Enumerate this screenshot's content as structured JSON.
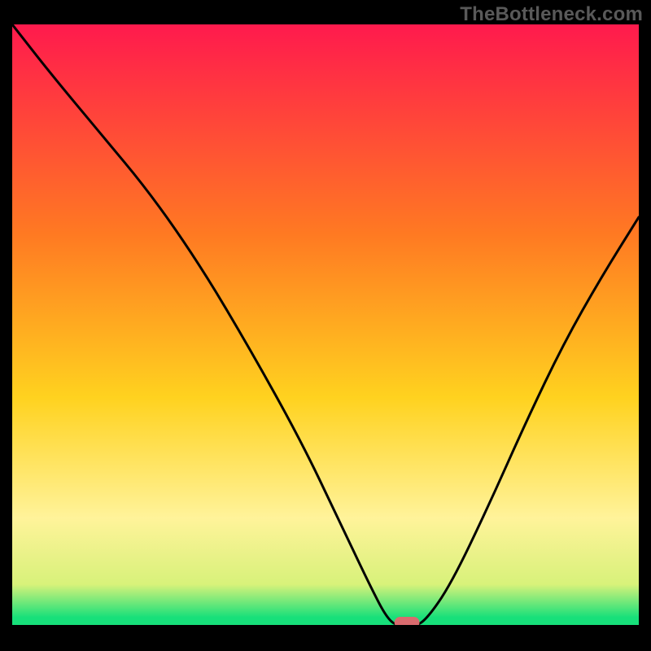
{
  "watermark": "TheBottleneck.com",
  "colors": {
    "plot_bg_top": "#ff1a4d",
    "plot_bg_mid1": "#ff7a22",
    "plot_bg_mid2": "#ffd21f",
    "plot_bg_low": "#fff39a",
    "plot_bg_green": "#17e07a",
    "curve": "#000000",
    "marker": "#d96b6e",
    "frame": "#000000"
  },
  "chart_data": {
    "type": "line",
    "title": "",
    "xlabel": "",
    "ylabel": "",
    "xlim": [
      0,
      100
    ],
    "ylim": [
      0,
      100
    ],
    "x": [
      0,
      6,
      14,
      22,
      30,
      38,
      46,
      52,
      57,
      60,
      62,
      64,
      66,
      70,
      76,
      82,
      88,
      94,
      100
    ],
    "values": [
      100,
      92,
      82,
      72,
      60,
      46,
      31,
      18,
      7,
      1,
      0,
      0,
      1,
      7,
      20,
      34,
      47,
      58,
      68
    ],
    "marker": {
      "x_start": 61,
      "x_end": 65,
      "y": 0
    },
    "gradient_stops": [
      {
        "offset": 0,
        "color": "#ff1a4d"
      },
      {
        "offset": 0.35,
        "color": "#ff7a22"
      },
      {
        "offset": 0.62,
        "color": "#ffd21f"
      },
      {
        "offset": 0.82,
        "color": "#fff39a"
      },
      {
        "offset": 0.93,
        "color": "#d8f27a"
      },
      {
        "offset": 0.985,
        "color": "#17e07a"
      },
      {
        "offset": 1.0,
        "color": "#17e07a"
      }
    ]
  }
}
